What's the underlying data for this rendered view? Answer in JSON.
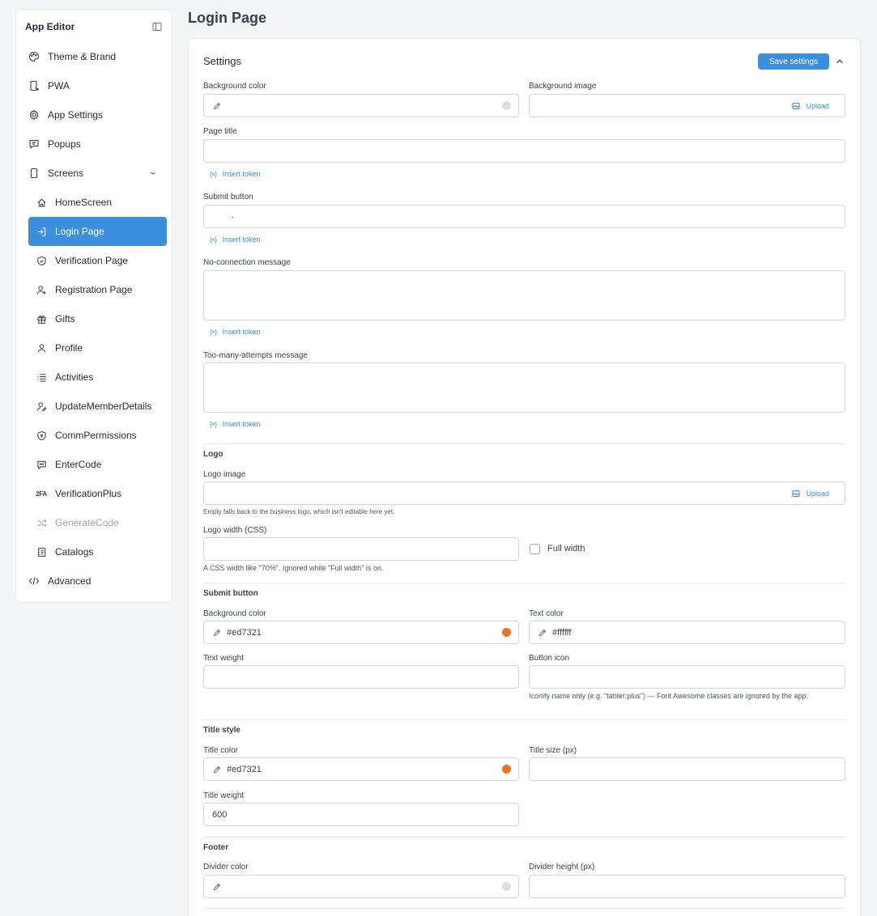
{
  "sidebar": {
    "title": "App Editor",
    "items": [
      {
        "label": "Theme & Brand",
        "icon": "palette-icon"
      },
      {
        "label": "PWA",
        "icon": "device-arrow-icon"
      },
      {
        "label": "App Settings",
        "icon": "settings-gear-icon"
      },
      {
        "label": "Popups",
        "icon": "message-icon"
      },
      {
        "label": "Screens",
        "icon": "phone-icon"
      }
    ],
    "screens": [
      {
        "label": "HomeScreen",
        "icon": "home-icon"
      },
      {
        "label": "Login Page",
        "icon": "login-icon"
      },
      {
        "label": "Verification Page",
        "icon": "shield-check-icon"
      },
      {
        "label": "Registration Page",
        "icon": "user-plus-icon"
      },
      {
        "label": "Gifts",
        "icon": "gift-icon"
      },
      {
        "label": "Profile",
        "icon": "user-icon"
      },
      {
        "label": "Activities",
        "icon": "list-icon"
      },
      {
        "label": "UpdateMemberDetails",
        "icon": "user-edit-icon"
      },
      {
        "label": "CommPermissions",
        "icon": "shield-lock-icon"
      },
      {
        "label": "EnterCode",
        "icon": "message-dots-icon"
      },
      {
        "label": "VerificationPlus",
        "icon": "2fa-icon",
        "icon_text": "2FA"
      },
      {
        "label": "GenerateCode",
        "icon": "arrows-shuffle-icon"
      },
      {
        "label": "Catalogs",
        "icon": "catalog-icon"
      }
    ],
    "advanced": {
      "label": "Advanced",
      "icon": "code-icon"
    }
  },
  "page": {
    "title": "Login Page"
  },
  "settings": {
    "title": "Settings",
    "save_label": "Save settings",
    "background_color_label": "Background color",
    "background_color_value": "",
    "background_color_swatch": "#dedede",
    "background_image_label": "Background image",
    "upload_label": "Upload",
    "page_title_label": "Page title",
    "insert_token_label": "Insert token",
    "token_icon": "{×}",
    "submit_button_label": "Submit button",
    "submit_button_value": ".",
    "no_connection_label": "No-connection message",
    "too_many_attempts_label": "Too-many-attempts message"
  },
  "logo": {
    "section": "Logo",
    "image_label": "Logo image",
    "upload_label": "Upload",
    "image_hint": "Empty falls back to the business logo, which isn't editable here yet.",
    "width_label": "Logo width (CSS)",
    "full_width_label": "Full width",
    "width_hint": "A CSS width like \"70%\". Ignored while \"Full width\" is on."
  },
  "submit": {
    "section": "Submit button",
    "bg_label": "Background color",
    "bg_value": "#ed7321",
    "bg_swatch": "#ed7321",
    "text_color_label": "Text color",
    "text_color_value": "#ffffff",
    "text_weight_label": "Text weight",
    "button_icon_label": "Button icon",
    "button_icon_hint": "Iconify name only (e.g. \"tabler:plus\") — Font Awesome classes are ignored by the app."
  },
  "title_style": {
    "section": "Title style",
    "color_label": "Title color",
    "color_value": "#ed7321",
    "color_swatch": "#ed7321",
    "size_label": "Title size (px)",
    "weight_label": "Title weight",
    "weight_value": "600"
  },
  "footer": {
    "section": "Footer",
    "divider_color_label": "Divider color",
    "divider_color_swatch": "#dedede",
    "divider_height_label": "Divider height (px)"
  }
}
